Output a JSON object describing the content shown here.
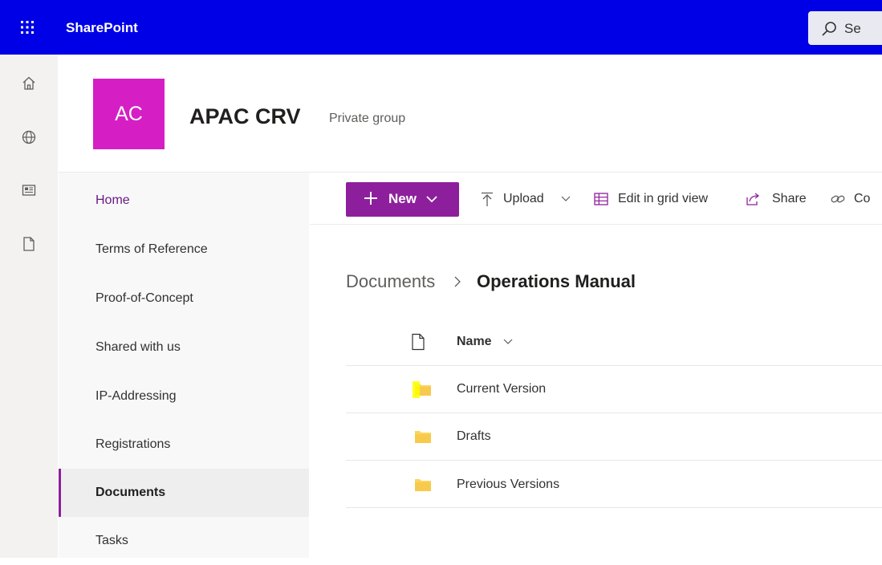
{
  "suitebar": {
    "brand": "SharePoint",
    "search_text": "Se"
  },
  "site": {
    "logo_initials": "AC",
    "title": "APAC CRV",
    "subtitle": "Private group"
  },
  "nav": {
    "items": [
      {
        "label": "Home"
      },
      {
        "label": "Terms of Reference"
      },
      {
        "label": "Proof-of-Concept"
      },
      {
        "label": "Shared with us"
      },
      {
        "label": "IP-Addressing"
      },
      {
        "label": "Registrations"
      },
      {
        "label": "Documents"
      },
      {
        "label": "Tasks"
      }
    ],
    "active": "Documents"
  },
  "commandbar": {
    "new_label": "New",
    "upload_label": "Upload",
    "grid_label": "Edit in grid view",
    "share_label": "Share",
    "copy_label": "Co"
  },
  "breadcrumb": {
    "root": "Documents",
    "current": "Operations Manual"
  },
  "list": {
    "column_name": "Name",
    "rows": [
      {
        "name": "Current Version"
      },
      {
        "name": "Drafts"
      },
      {
        "name": "Previous Versions"
      }
    ]
  },
  "colors": {
    "suitebar": "#0000e6",
    "accent": "#8e1f9c",
    "site_logo": "#d51fc5",
    "folder": "#fcd460",
    "highlight": "#ffff00"
  },
  "icons": {
    "waffle": "waffle-icon",
    "search": "search-icon",
    "rail": [
      "home-icon",
      "globe-icon",
      "news-icon",
      "file-icon"
    ],
    "upload": "upload-icon",
    "grid": "grid-icon",
    "share": "share-icon",
    "copy_link": "link-icon",
    "folder": "folder-icon"
  }
}
